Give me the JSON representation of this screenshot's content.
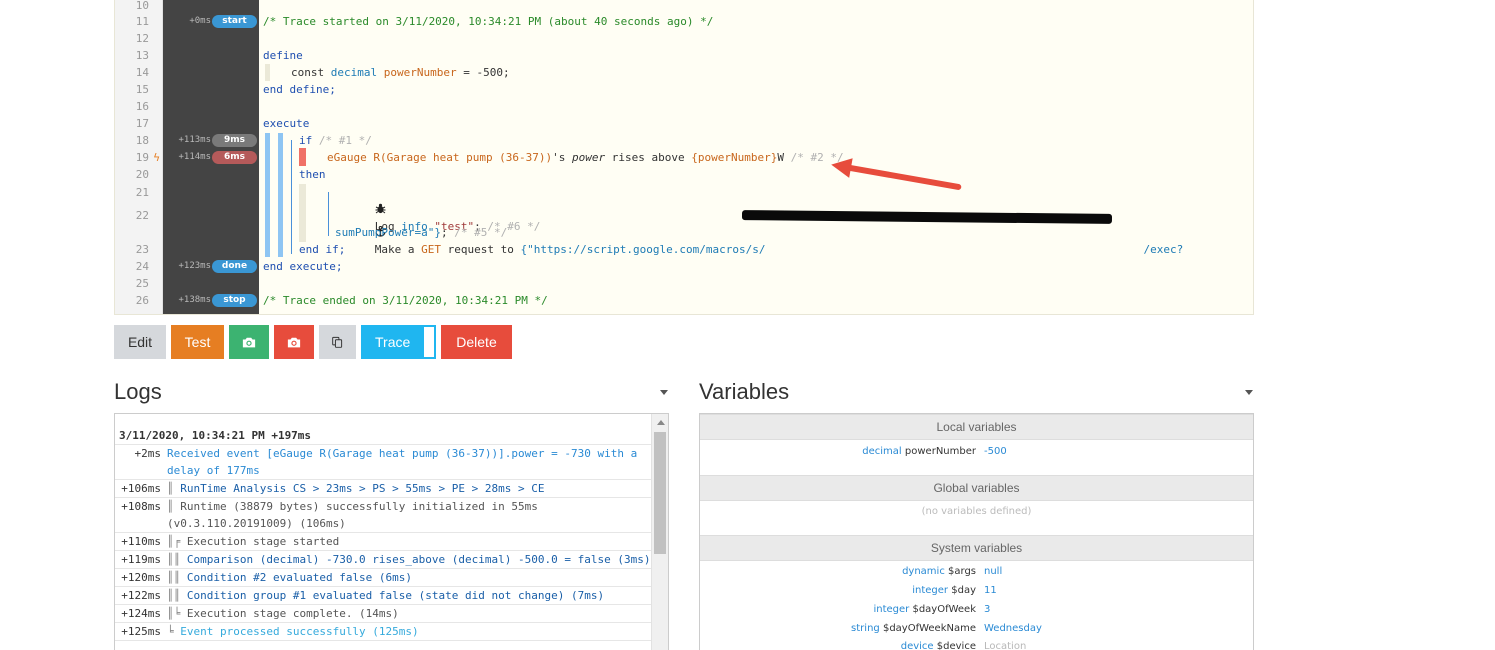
{
  "code": {
    "lines": [
      {
        "n": "10"
      },
      {
        "n": "11",
        "time": "+0ms",
        "badge": "start",
        "text": "/* Trace started on 3/11/2020, 10:34:21 PM (about 40 seconds ago) */"
      },
      {
        "n": "12"
      },
      {
        "n": "13",
        "text": "define"
      },
      {
        "n": "14",
        "kw1": "const",
        "type": "decimal",
        "var": "powerNumber",
        "rest": " = -500;"
      },
      {
        "n": "15",
        "text": "end define;"
      },
      {
        "n": "16"
      },
      {
        "n": "17",
        "text": "execute"
      },
      {
        "n": "18",
        "time": "+113ms",
        "badge": "9ms",
        "kw1": "if",
        "cmt": "/* #1 */"
      },
      {
        "n": "19",
        "time": "+114ms",
        "badge": "6ms",
        "dev": "eGauge R(Garage heat pump (36-37))",
        "attr": "'s ",
        "attr_name": "power",
        "op": " rises above ",
        "val": "{powerNumber}",
        "unit": "W",
        "cmt": "/* #2 */"
      },
      {
        "n": "20",
        "text": "then"
      },
      {
        "n": "21",
        "kw1": "Log",
        "type": "info",
        "str": "\"test\"",
        "cmt": "/* #6 */"
      },
      {
        "n": "22",
        "a": "Make a ",
        "b": "GET",
        "c": " request to ",
        "d": "{\"https://script.google.com/macros/s/",
        "e": "/exec?"
      },
      {
        "n": "",
        "a": "sumPumpPower=a\"}",
        "b": "; ",
        "cmt": "/* #5 */"
      },
      {
        "n": "23",
        "text": "end if;"
      },
      {
        "n": "24",
        "time": "+123ms",
        "badge": "done",
        "text": "end execute;"
      },
      {
        "n": "25"
      },
      {
        "n": "26",
        "time": "+138ms",
        "badge": "stop",
        "text": "/* Trace ended on 3/11/2020, 10:34:21 PM */"
      }
    ]
  },
  "toolbar": {
    "edit": "Edit",
    "test": "Test",
    "trace": "Trace",
    "delete": "Delete"
  },
  "logs": {
    "title": "Logs",
    "date": "3/11/2020, 10:34:21 PM +197ms",
    "rows": [
      {
        "t": "+2ms",
        "pipe": "",
        "msg": "Received event [eGauge R(Garage heat pump (36-37))].power = -730 with a delay of 177ms",
        "style": "info"
      },
      {
        "t": "+106ms",
        "pipe": "║ ",
        "msg": "RunTime Analysis CS > 23ms > PS > 55ms > PE > 28ms > CE",
        "style": "blue"
      },
      {
        "t": "+108ms",
        "pipe": "║ ",
        "msg": "Runtime (38879 bytes) successfully initialized in 55ms (v0.3.110.20191009) (106ms)",
        "style": "gray"
      },
      {
        "t": "+110ms",
        "pipe": "║╒ ",
        "msg": "Execution stage started",
        "style": "gray"
      },
      {
        "t": "+119ms",
        "pipe": "║║ ",
        "msg": "Comparison (decimal) -730.0 rises_above (decimal) -500.0 = false (3ms)",
        "style": "blue"
      },
      {
        "t": "+120ms",
        "pipe": "║║ ",
        "msg": "Condition #2 evaluated false (6ms)",
        "style": "blue"
      },
      {
        "t": "+122ms",
        "pipe": "║║ ",
        "msg": "Condition group #1 evaluated false (state did not change) (7ms)",
        "style": "blue"
      },
      {
        "t": "+124ms",
        "pipe": "║╘ ",
        "msg": "Execution stage complete. (14ms)",
        "style": "gray"
      },
      {
        "t": "+125ms",
        "pipe": "╘ ",
        "msg": "Event processed successfully (125ms)",
        "style": "ok"
      }
    ]
  },
  "variables": {
    "title": "Variables",
    "local_header": "Local variables",
    "global_header": "Global variables",
    "system_header": "System variables",
    "global_empty": "(no variables defined)",
    "local": [
      {
        "type": "decimal",
        "name": "powerNumber",
        "value": "-500"
      }
    ],
    "system": [
      {
        "type": "dynamic",
        "name": "$args",
        "value": "null"
      },
      {
        "type": "integer",
        "name": "$day",
        "value": "11"
      },
      {
        "type": "integer",
        "name": "$dayOfWeek",
        "value": "3"
      },
      {
        "type": "string",
        "name": "$dayOfWeekName",
        "value": "Wednesday"
      },
      {
        "type": "device",
        "name": "$device",
        "value": "Location"
      }
    ]
  },
  "colors": {
    "badge_blue": "#3a97d4",
    "badge_gray": "#7a7a7a",
    "badge_red": "#b55a5a",
    "arrow": "#e74c3c"
  },
  "icons": {
    "bug": "bug-icon",
    "anchor": "anchor-icon",
    "camera": "camera-icon",
    "copy": "copy-icon",
    "bolt": "lightning-icon"
  }
}
